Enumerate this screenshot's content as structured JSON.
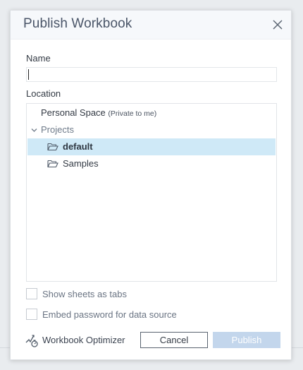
{
  "dialog": {
    "title": "Publish Workbook"
  },
  "name_field": {
    "label": "Name",
    "value": ""
  },
  "location": {
    "label": "Location",
    "personal_space": "Personal Space",
    "personal_space_note": "(Private to me)",
    "projects_label": "Projects",
    "folders": [
      {
        "label": "default",
        "selected": true
      },
      {
        "label": "Samples",
        "selected": false
      }
    ]
  },
  "options": {
    "show_sheets_as_tabs": {
      "label": "Show sheets as tabs",
      "checked": false
    },
    "embed_password": {
      "label": "Embed password for data source",
      "checked": false
    }
  },
  "footer": {
    "optimizer_label": "Workbook Optimizer",
    "cancel_label": "Cancel",
    "publish_label": "Publish"
  },
  "colors": {
    "selection": "#cfe9f7",
    "publish_disabled": "#c3d6ec",
    "header_bg": "#f6f8fb"
  },
  "icons": {
    "close": "close-icon",
    "expand": "chevron-down-icon",
    "folder": "folder-open-icon",
    "optimizer": "workbook-optimizer-icon"
  }
}
